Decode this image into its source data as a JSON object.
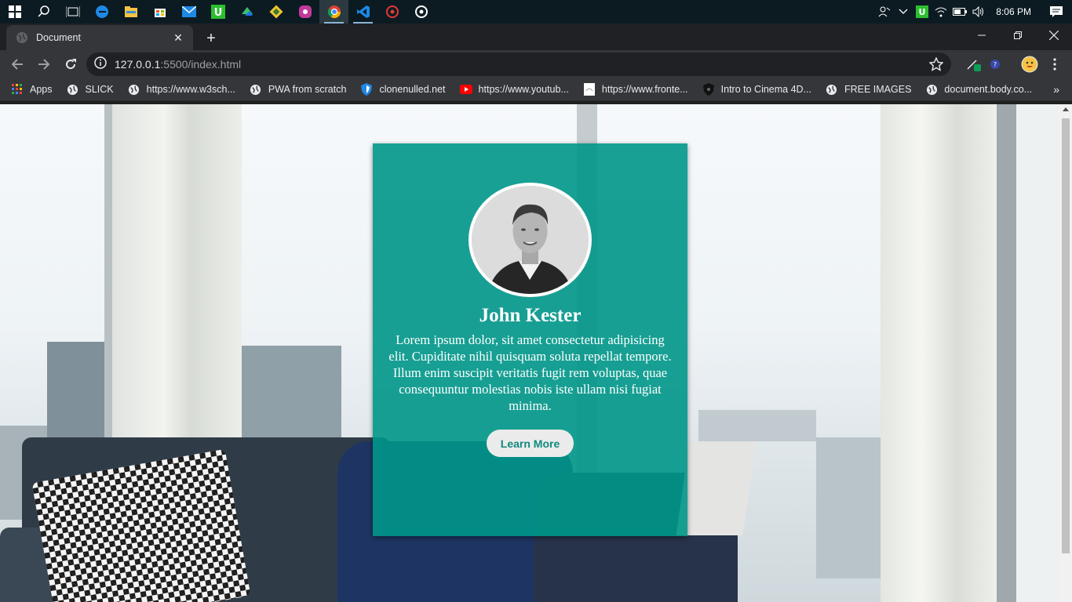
{
  "taskbar": {
    "icons": [
      "windows-start-icon",
      "search-icon",
      "task-view-icon",
      "edge-icon",
      "file-explorer-icon",
      "store-icon",
      "mail-icon",
      "upwork-icon",
      "app-icon",
      "git-icon",
      "app-purple-icon",
      "chrome-icon",
      "vscode-icon",
      "app-red-icon",
      "app-circle-icon"
    ],
    "clock": "8:06 PM"
  },
  "browser": {
    "tab_title": "Document",
    "url_host": "127.0.0.1",
    "url_rest": ":5500/index.html",
    "colors": {
      "frame": "#202124",
      "toolbar": "#35363a",
      "text": "#e8eaed"
    }
  },
  "bookmarks": [
    {
      "label": "Apps",
      "icon": "apps-grid-icon"
    },
    {
      "label": "SLICK",
      "icon": "globe-icon"
    },
    {
      "label": "https://www.w3sch...",
      "icon": "globe-icon"
    },
    {
      "label": "PWA from scratch",
      "icon": "globe-icon"
    },
    {
      "label": "clonenulled.net",
      "icon": "shield-icon"
    },
    {
      "label": "https://www.youtub...",
      "icon": "youtube-icon"
    },
    {
      "label": "https://www.fronte...",
      "icon": "page-icon"
    },
    {
      "label": "Intro to Cinema 4D...",
      "icon": "cinema4d-icon"
    },
    {
      "label": "FREE IMAGES",
      "icon": "globe-icon"
    },
    {
      "label": "document.body.co...",
      "icon": "globe-icon"
    }
  ],
  "card": {
    "name": "John Kester",
    "text": "Lorem ipsum dolor, sit amet consectetur adipisicing elit. Cupiditate nihil quisquam soluta repellat tempore. Illum enim suscipit veritatis fugit rem voluptas, quae consequuntur molestias nobis iste ullam nisi fugiat minima.",
    "button": "Learn More",
    "color": "#009688"
  }
}
